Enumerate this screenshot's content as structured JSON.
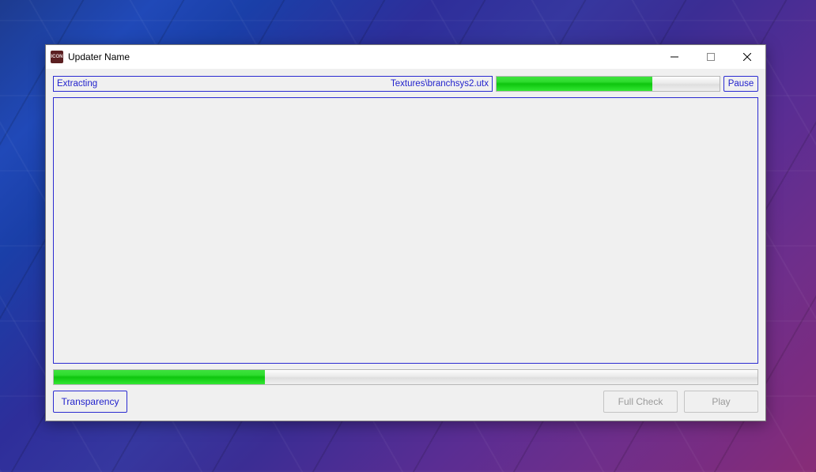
{
  "window": {
    "title": "Updater Name",
    "icon_label": "ICON"
  },
  "status": {
    "action": "Extracting",
    "file": "Textures\\branchsys2.utx"
  },
  "progress": {
    "file_percent": 70,
    "total_percent": 30
  },
  "buttons": {
    "pause": "Pause",
    "transparency": "Transparency",
    "full_check": "Full Check",
    "play": "Play"
  }
}
